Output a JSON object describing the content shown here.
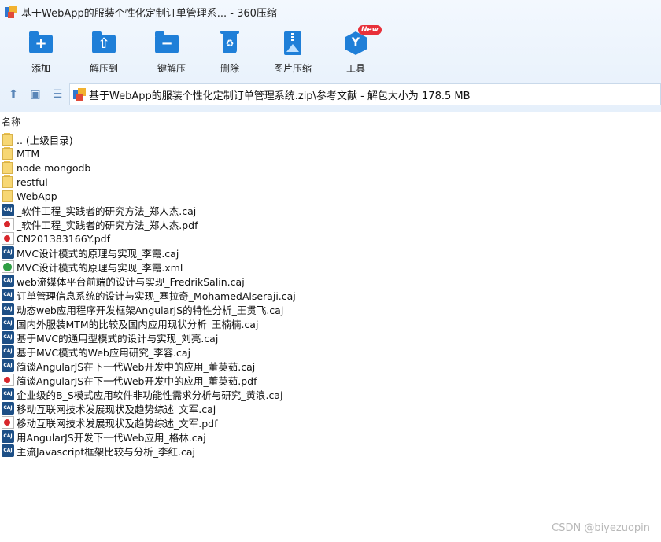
{
  "window": {
    "title": "基于WebApp的服装个性化定制订单管理系... - 360压缩"
  },
  "toolbar": {
    "tools": [
      {
        "label": "添加",
        "icon": "add-icon"
      },
      {
        "label": "解压到",
        "icon": "extract-to-icon"
      },
      {
        "label": "一键解压",
        "icon": "one-click-extract-icon"
      },
      {
        "label": "删除",
        "icon": "delete-icon"
      },
      {
        "label": "图片压缩",
        "icon": "image-compress-icon"
      },
      {
        "label": "工具",
        "icon": "tools-icon",
        "badge": "New"
      }
    ]
  },
  "nav": {
    "path": "基于WebApp的服装个性化定制订单管理系统.zip\\参考文献 - 解包大小为 178.5 MB"
  },
  "list": {
    "column_name": "名称",
    "items": [
      {
        "name": ".. (上级目录)",
        "type": "folder"
      },
      {
        "name": "MTM",
        "type": "folder"
      },
      {
        "name": "node mongodb",
        "type": "folder"
      },
      {
        "name": "restful",
        "type": "folder"
      },
      {
        "name": "WebApp",
        "type": "folder"
      },
      {
        "name": "_软件工程_实践者的研究方法_郑人杰.caj",
        "type": "caj"
      },
      {
        "name": "_软件工程_实践者的研究方法_郑人杰.pdf",
        "type": "pdf"
      },
      {
        "name": "CN201383166Y.pdf",
        "type": "pdf"
      },
      {
        "name": "MVC设计模式的原理与实现_李霞.caj",
        "type": "caj"
      },
      {
        "name": "MVC设计模式的原理与实现_李霞.xml",
        "type": "xml"
      },
      {
        "name": "web流媒体平台前端的设计与实现_FredrikSalin.caj",
        "type": "caj"
      },
      {
        "name": "订单管理信息系统的设计与实现_塞拉奇_MohamedAlseraji.caj",
        "type": "caj"
      },
      {
        "name": "动态web应用程序开发框架AngularJS的特性分析_王贯飞.caj",
        "type": "caj"
      },
      {
        "name": "国内外服装MTM的比较及国内应用现状分析_王楠楠.caj",
        "type": "caj"
      },
      {
        "name": "基于MVC的通用型模式的设计与实现_刘亮.caj",
        "type": "caj"
      },
      {
        "name": "基于MVC模式的Web应用研究_李容.caj",
        "type": "caj"
      },
      {
        "name": "简谈AngularJS在下一代Web开发中的应用_董英茹.caj",
        "type": "caj"
      },
      {
        "name": "简谈AngularJS在下一代Web开发中的应用_董英茹.pdf",
        "type": "pdf"
      },
      {
        "name": "企业级的B_S模式应用软件非功能性需求分析与研究_黄浪.caj",
        "type": "caj"
      },
      {
        "name": "移动互联网技术发展现状及趋势综述_文军.caj",
        "type": "caj"
      },
      {
        "name": "移动互联网技术发展现状及趋势综述_文军.pdf",
        "type": "pdf"
      },
      {
        "name": "用AngularJS开发下一代Web应用_格林.caj",
        "type": "caj"
      },
      {
        "name": "主流Javascript框架比较与分析_李红.caj",
        "type": "caj"
      }
    ]
  },
  "watermark": "CSDN @biyezuopin"
}
